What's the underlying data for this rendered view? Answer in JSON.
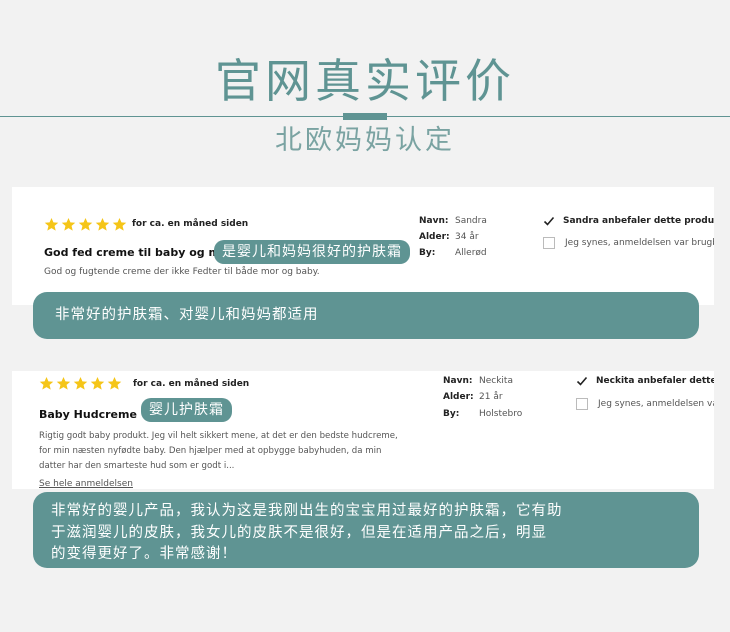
{
  "header": {
    "title": "官网真实评价",
    "subtitle": "北欧妈妈认定"
  },
  "reviews": [
    {
      "rating": 5,
      "when": "for ca. en måned siden",
      "title": "God fed creme til baby og mor:)",
      "body": "God og fugtende creme der ikke  Fedter til både mor og baby.",
      "meta": [
        {
          "key": "Navn:",
          "value": "Sandra"
        },
        {
          "key": "Alder:",
          "value": "34 år"
        },
        {
          "key": "By:",
          "value": "Allerød"
        }
      ],
      "recommend": "Sandra anbefaler dette produkt",
      "agree": "Jeg synes, anmeldelsen var brugbar",
      "tag": "是婴儿和妈妈很好的护肤霜",
      "translation": "非常好的护肤霜、对婴儿和妈妈都适用"
    },
    {
      "rating": 5,
      "when": "for ca. en måned siden",
      "title": "Baby Hudcreme",
      "body_lines": [
        "Rigtig godt baby produkt. Jeg vil helt sikkert mene, at det er den bedste hudcreme,",
        "for min næsten nyfødte baby. Den hjælper med at opbygge babyhuden, da min",
        "datter har den smarteste hud som er godt i..."
      ],
      "meta": [
        {
          "key": "Navn:",
          "value": "Neckita"
        },
        {
          "key": "Alder:",
          "value": "21 år"
        },
        {
          "key": "By:",
          "value": "Holstebro"
        }
      ],
      "recommend": "Neckita anbefaler dette produkt",
      "agree": "Jeg synes, anmeldelsen var brugbar",
      "link": "Se hele anmeldelsen",
      "tag": "婴儿护肤霜",
      "translation_lines": [
        "非常好的婴儿产品，我认为这是我刚出生的宝宝用过最好的护肤霜，它有助",
        "于滋润婴儿的皮肤，我女儿的皮肤不是很好，但是在适用产品之后，明显",
        "的变得更好了。非常感谢！"
      ]
    }
  ],
  "colors": {
    "accent": "#5f9493",
    "star": "#f5c518",
    "background": "#f2f2f2"
  }
}
